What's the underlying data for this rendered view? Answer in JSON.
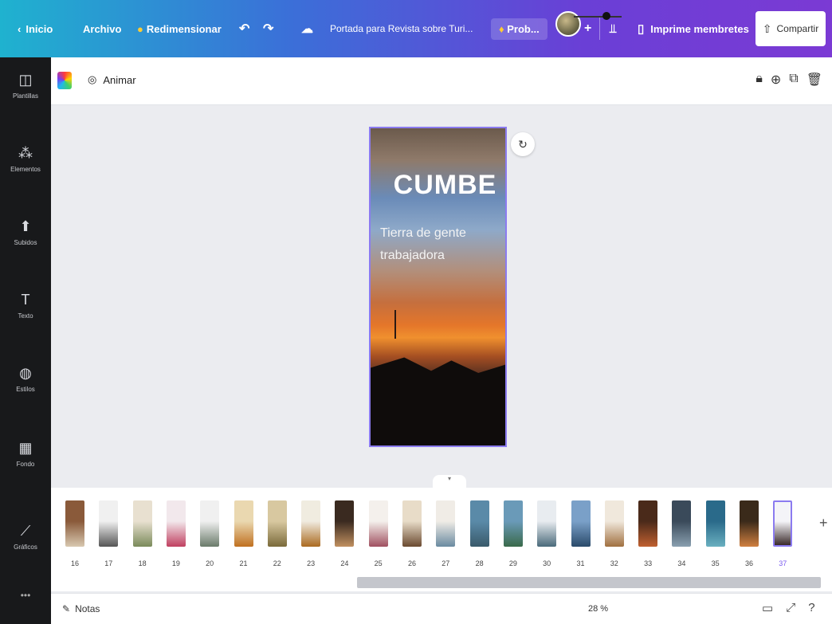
{
  "topbar": {
    "home": "Inicio",
    "file": "Archivo",
    "resize": "Redimensionar",
    "doc_title": "Portada para Revista sobre Turi...",
    "pro": "Prob...",
    "print": "Imprime membretes",
    "share": "Compartir"
  },
  "sidebar": {
    "items": [
      {
        "label": "Plantillas",
        "icon": "template-icon"
      },
      {
        "label": "Elementos",
        "icon": "elements-icon"
      },
      {
        "label": "Subidos",
        "icon": "upload-icon"
      },
      {
        "label": "Texto",
        "icon": "text-icon"
      },
      {
        "label": "Estilos",
        "icon": "styles-icon"
      },
      {
        "label": "Fondo",
        "icon": "background-icon"
      },
      {
        "label": "Gráficos",
        "icon": "charts-icon"
      }
    ]
  },
  "toolbar": {
    "animate": "Animar"
  },
  "page": {
    "title": "CUMBE",
    "subtitle_line1": "Tierra de gente",
    "subtitle_line2": "trabajadora"
  },
  "filmstrip": {
    "pages": [
      "16",
      "17",
      "18",
      "19",
      "20",
      "21",
      "22",
      "23",
      "24",
      "25",
      "26",
      "27",
      "28",
      "29",
      "30",
      "31",
      "32",
      "33",
      "34",
      "35",
      "36",
      "37"
    ],
    "selected": "37"
  },
  "bottombar": {
    "notes": "Notas",
    "zoom": "28 %"
  }
}
